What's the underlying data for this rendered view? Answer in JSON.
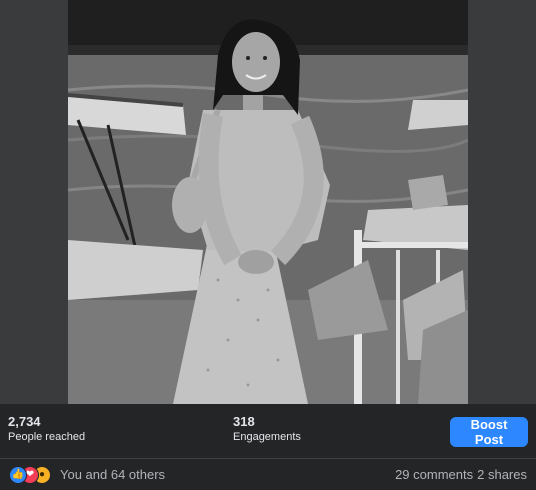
{
  "photo": {
    "alt_icon": "photo-image"
  },
  "stats": {
    "reached_value": "2,734",
    "reached_label": "People reached",
    "engagements_value": "318",
    "engagements_label": "Engagements",
    "boost_label": "Boost Post"
  },
  "reactions": {
    "summary": "You and 64 others",
    "comments": "29 comments",
    "shares": "2 shares",
    "icons": [
      "like-icon",
      "love-icon",
      "wow-icon"
    ]
  },
  "colors": {
    "accent": "#2d88ff",
    "background": "#242526",
    "secondary_text": "#b0b3b8"
  }
}
